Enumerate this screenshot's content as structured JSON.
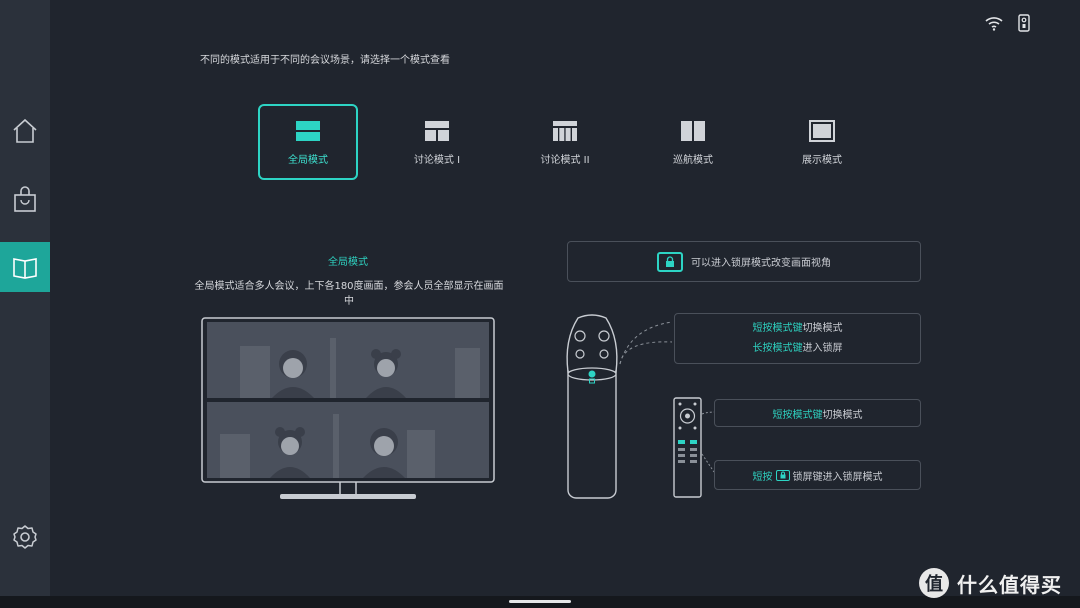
{
  "instruction": "不同的模式适用于不同的会议场景，请选择一个模式查看",
  "sidebar": {
    "items": [
      {
        "icon": "home-icon",
        "active": false
      },
      {
        "icon": "bag-icon",
        "active": false
      },
      {
        "icon": "book-icon",
        "active": true
      },
      {
        "icon": "gear-icon",
        "active": false
      }
    ]
  },
  "status": {
    "wifi_icon": "wifi-icon",
    "remote_icon": "remote-icon"
  },
  "modes": [
    {
      "label": "全局模式",
      "selected": true
    },
    {
      "label": "讨论模式 I",
      "selected": false
    },
    {
      "label": "讨论模式 II",
      "selected": false
    },
    {
      "label": "巡航模式",
      "selected": false
    },
    {
      "label": "展示模式",
      "selected": false
    }
  ],
  "description": {
    "title": "全局模式",
    "text": "全局模式适合多人会议，上下各180度画面，参会人员全部显示在画面中"
  },
  "hints": {
    "lock_hint": "可以进入锁屏模式改变画面视角",
    "device_short_key": "短按模式键",
    "device_short_action": "切换模式",
    "device_long_key": "长按模式键",
    "device_long_action": "进入锁屏",
    "remote_short_key": "短按模式键",
    "remote_short_action": "切换模式",
    "remote_lock_prefix": "短按",
    "remote_lock_action": "锁屏键进入锁屏模式"
  },
  "watermark": {
    "logo": "值",
    "text": "什么值得买"
  },
  "colors": {
    "accent": "#2dd4c4",
    "background": "#20252e",
    "sidebar": "#2b313b"
  }
}
